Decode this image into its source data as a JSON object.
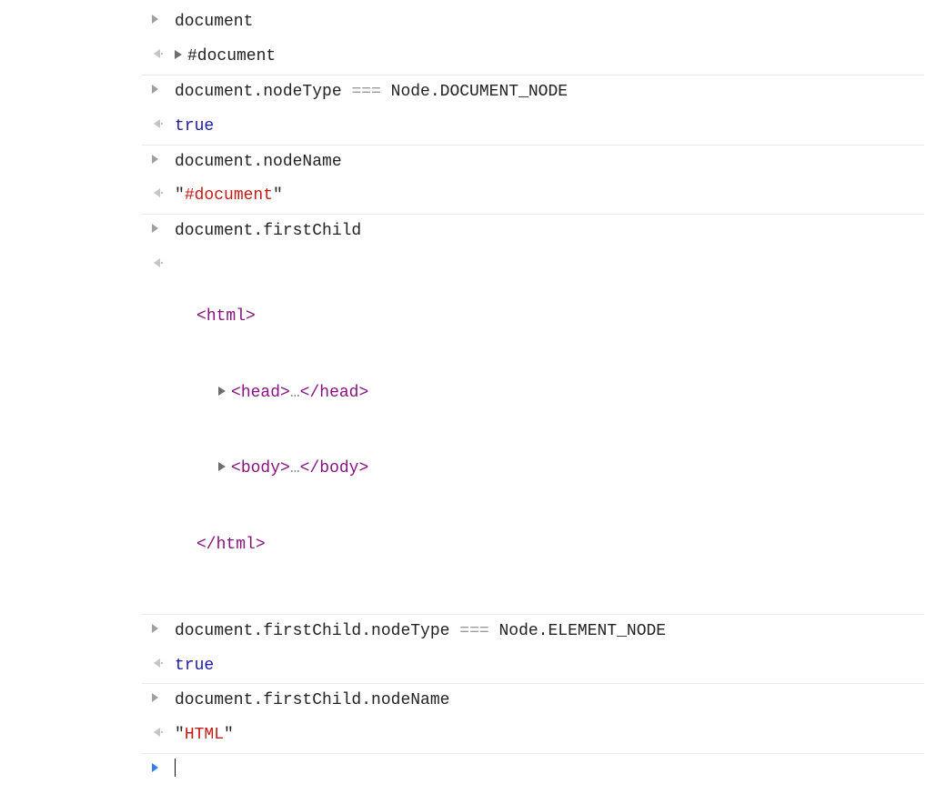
{
  "entries": {
    "e0_input": "document",
    "e0_output": "#document",
    "e1_input_pre": "document.nodeType ",
    "e1_input_op": "===",
    "e1_input_post": " Node.DOCUMENT_NODE",
    "e1_output": "true",
    "e2_input": "document.nodeName",
    "e2_output_val": "#document",
    "e3_input": "document.firstChild",
    "e3_html_open_tag": "html",
    "e3_head_tag": "head",
    "e3_body_tag": "body",
    "e3_html_close_tag": "html",
    "e4_input_pre": "document.firstChild.nodeType ",
    "e4_input_op": "===",
    "e4_input_post": " Node.ELEMENT_NODE",
    "e4_output": "true",
    "e5_input": "document.firstChild.nodeName",
    "e5_output_val": "HTML"
  }
}
